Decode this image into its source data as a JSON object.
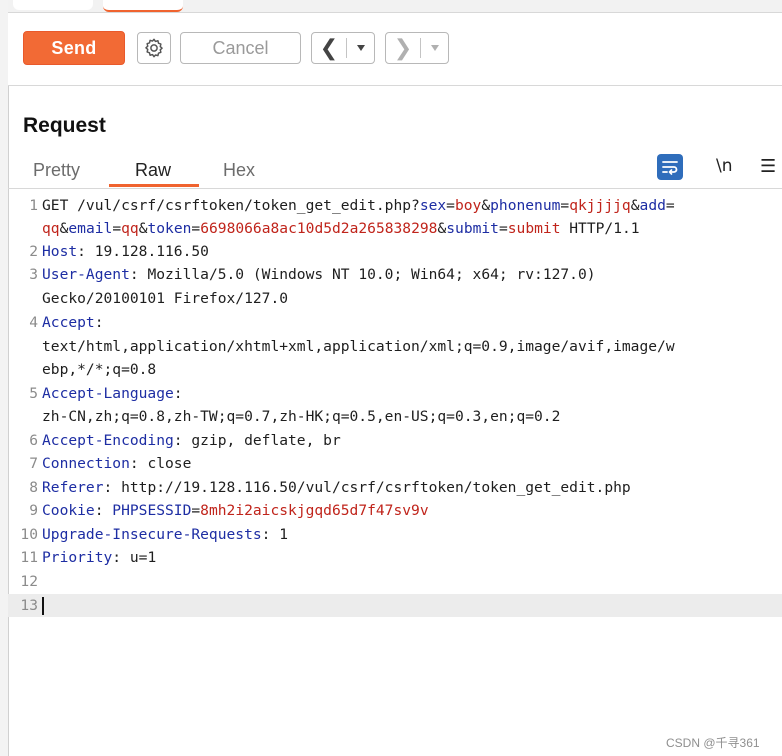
{
  "toolbar": {
    "send_label": "Send",
    "cancel_label": "Cancel",
    "settings_icon": "gear-icon",
    "back_icon": "chevron-left-icon",
    "forward_icon": "chevron-right-icon"
  },
  "request": {
    "title": "Request",
    "tabs": [
      {
        "label": "Pretty",
        "active": false
      },
      {
        "label": "Raw",
        "active": true
      },
      {
        "label": "Hex",
        "active": false
      }
    ],
    "newline_label": "\\n"
  },
  "lines": [
    {
      "num": "1",
      "code": ""
    },
    {
      "num": "",
      "code": ""
    },
    {
      "num": "2",
      "code": ""
    },
    {
      "num": "3",
      "code": ""
    },
    {
      "num": "",
      "code": ""
    },
    {
      "num": "4",
      "code": ""
    },
    {
      "num": "",
      "code": ""
    },
    {
      "num": "",
      "code": ""
    },
    {
      "num": "5",
      "code": ""
    },
    {
      "num": "",
      "code": ""
    },
    {
      "num": "6",
      "code": ""
    },
    {
      "num": "7",
      "code": ""
    },
    {
      "num": "8",
      "code": ""
    },
    {
      "num": "9",
      "code": ""
    },
    {
      "num": "10",
      "code": ""
    },
    {
      "num": "11",
      "code": ""
    },
    {
      "num": "12",
      "code": ""
    },
    {
      "num": "13",
      "code": ""
    }
  ],
  "http": {
    "l1a_method_path": "GET /vul/csrf/csrftoken/token_get_edit.php?",
    "l1a_k1": "sex",
    "l1a_eq1": "=",
    "l1a_v1": "boy",
    "l1a_amp1": "&",
    "l1a_k2": "phonenum",
    "l1a_eq2": "=",
    "l1a_v2": "qkjjjjq",
    "l1a_amp2": "&",
    "l1a_k3": "add",
    "l1a_eq3": "=",
    "l1b_v3": "qq",
    "l1b_amp3": "&",
    "l1b_k4": "email",
    "l1b_eq4": "=",
    "l1b_v4": "qq",
    "l1b_amp4": "&",
    "l1b_k5": "token",
    "l1b_eq5": "=",
    "l1b_v5": "6698066a8ac10d5d2a265838298",
    "l1b_amp5": "&",
    "l1b_k6": "submit",
    "l1b_eq6": "=",
    "l1b_v6": "submit",
    "l1b_proto": " HTTP/1.1",
    "host_key": "Host",
    "host_val": ": 19.128.116.50",
    "ua_key": "User-Agent",
    "ua_val": ": Mozilla/5.0 (Windows NT 10.0; Win64; x64; rv:127.0)",
    "ua_cont": "Gecko/20100101 Firefox/127.0",
    "accept_key": "Accept",
    "accept_colon": ":",
    "accept_val1": "text/html,application/xhtml+xml,application/xml;q=0.9,image/avif,image/w",
    "accept_val2": "ebp,*/*;q=0.8",
    "al_key": "Accept-Language",
    "al_colon": ":",
    "al_val": "zh-CN,zh;q=0.8,zh-TW;q=0.7,zh-HK;q=0.5,en-US;q=0.3,en;q=0.2",
    "ae_key": "Accept-Encoding",
    "ae_val": ": gzip, deflate, br",
    "conn_key": "Connection",
    "conn_val": ": close",
    "ref_key": "Referer",
    "ref_val": ": http://19.128.116.50/vul/csrf/csrftoken/token_get_edit.php",
    "cookie_key": "Cookie",
    "cookie_colon": ": ",
    "cookie_name": "PHPSESSID",
    "cookie_eq": "=",
    "cookie_val": "8mh2i2aicskjgqd65d7f47sv9v",
    "uir_key": "Upgrade-Insecure-Requests",
    "uir_val": ": 1",
    "prio_key": "Priority",
    "prio_val": ": u=1"
  },
  "watermark": "CSDN @千寻361",
  "colors": {
    "accent": "#f26a35",
    "key": "#1d2da3",
    "value": "#c0241b",
    "wrap_button": "#2f6dbb"
  }
}
